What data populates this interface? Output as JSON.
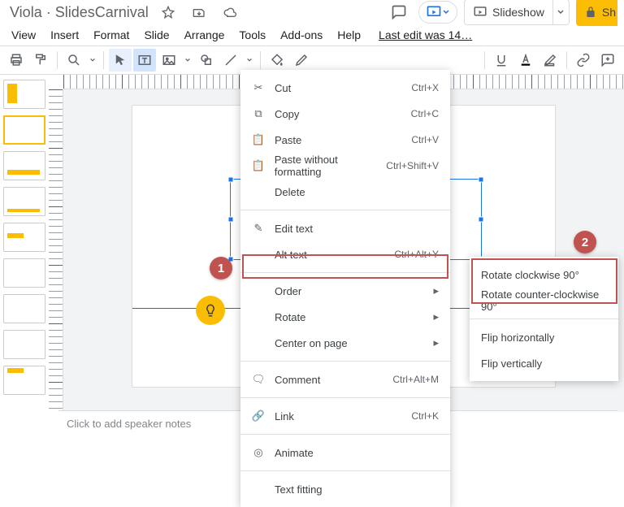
{
  "header": {
    "title": "Viola · SlidesCarnival",
    "slideshow": "Slideshow",
    "share": "Sh"
  },
  "menu": {
    "view": "View",
    "insert": "Insert",
    "format": "Format",
    "slide": "Slide",
    "arrange": "Arrange",
    "tools": "Tools",
    "addons": "Add-ons",
    "help": "Help",
    "lastEdit": "Last edit was 14…"
  },
  "context": {
    "cut": "Cut",
    "cut_sc": "Ctrl+X",
    "copy": "Copy",
    "copy_sc": "Ctrl+C",
    "paste": "Paste",
    "paste_sc": "Ctrl+V",
    "pwf": "Paste without formatting",
    "pwf_sc": "Ctrl+Shift+V",
    "delete": "Delete",
    "editText": "Edit text",
    "altText": "Alt text",
    "altText_sc": "Ctrl+Alt+Y",
    "order": "Order",
    "rotate": "Rotate",
    "center": "Center on page",
    "comment": "Comment",
    "comment_sc": "Ctrl+Alt+M",
    "link": "Link",
    "link_sc": "Ctrl+K",
    "animate": "Animate",
    "textFitting": "Text fitting"
  },
  "submenu": {
    "cw": "Rotate clockwise 90°",
    "ccw": "Rotate counter-clockwise 90°",
    "flipH": "Flip horizontally",
    "flipV": "Flip vertically"
  },
  "speakerNotes": "Click to add speaker notes",
  "anno": {
    "one": "1",
    "two": "2"
  }
}
